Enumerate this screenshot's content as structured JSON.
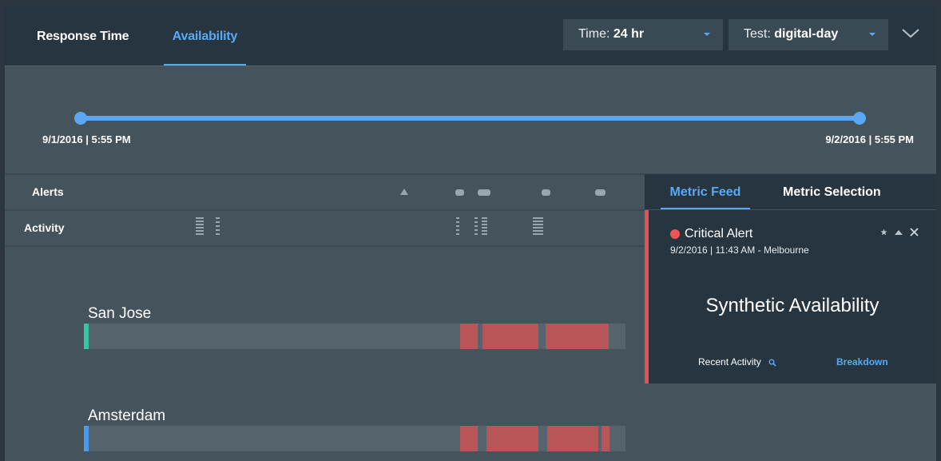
{
  "header": {
    "tabs": [
      {
        "label": "Response Time",
        "active": false
      },
      {
        "label": "Availability",
        "active": true
      }
    ],
    "time_dropdown": {
      "label": "Time: ",
      "value": "24 hr"
    },
    "test_dropdown": {
      "label": "Test: ",
      "value": "digital-day"
    }
  },
  "timeline": {
    "start": "9/1/2016 | 5:55 PM",
    "end": "9/2/2016 | 5:55 PM"
  },
  "rows": {
    "alerts_label": "Alerts",
    "activity_label": "Activity"
  },
  "locations": [
    {
      "name": "San Jose",
      "edge_color": "#35c7a5"
    },
    {
      "name": "Amsterdam",
      "edge_color": "#4a9af0"
    }
  ],
  "panel": {
    "tabs": [
      {
        "label": "Metric Feed",
        "active": true
      },
      {
        "label": "Metric Selection",
        "active": false
      }
    ],
    "card": {
      "title": "Critical Alert",
      "date": "9/2/2016 | 11:43 AM - Melbourne",
      "metric": "Synthetic Availability",
      "recent_activity": "Recent Activity",
      "breakdown": "Breakdown"
    }
  },
  "colors": {
    "accent": "#59a9f5",
    "critical": "#f05454",
    "outage": "#b85557",
    "background": "#45535d",
    "header": "#273540"
  },
  "icons": [
    "chevron-down-icon",
    "caret-down-icon",
    "triangle-alert-icon",
    "star-icon",
    "caret-up-icon",
    "close-icon",
    "search-icon"
  ]
}
